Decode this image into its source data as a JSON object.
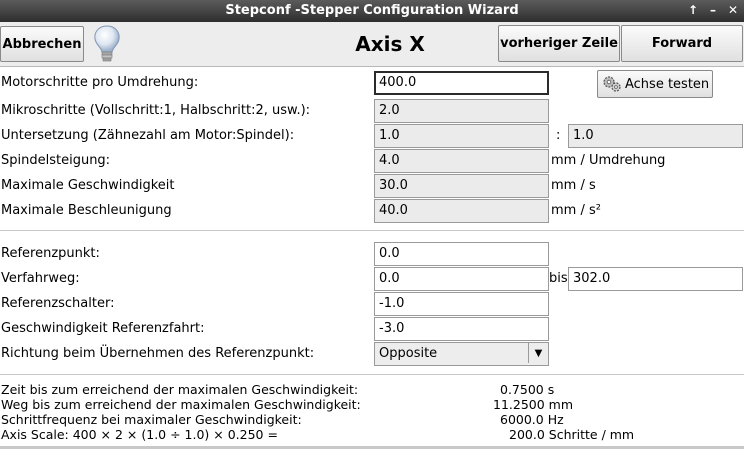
{
  "window": {
    "title": "Stepconf -Stepper Configuration Wizard"
  },
  "toolbar": {
    "cancel_label": "Abbrechen",
    "heading": "Axis X",
    "prev_label": "vorheriger Zeile",
    "forward_label": "Forward"
  },
  "motor": {
    "steps_label": "Motorschritte pro Umdrehung:",
    "steps_value": "400.0",
    "test_label": "Achse testen",
    "micro_label": "Mikroschritte (Vollschritt:1, Halbschritt:2, usw.):",
    "micro_value": "2.0",
    "gear_label": "Untersetzung (Zähnezahl am Motor:Spindel):",
    "gear_motor": "1.0",
    "gear_sep": ":",
    "gear_spindle": "1.0",
    "pitch_label": "Spindelsteigung:",
    "pitch_value": "4.0",
    "pitch_unit": "mm / Umdrehung",
    "speed_label": "Maximale Geschwindigkeit",
    "speed_value": "30.0",
    "speed_unit": "mm / s",
    "accel_label": "Maximale Beschleunigung",
    "accel_value": "40.0",
    "accel_unit": "mm / s²"
  },
  "homing": {
    "home_label": "Referenzpunkt:",
    "home_value": "0.0",
    "travel_label": "Verfahrweg:",
    "travel_min": "0.0",
    "travel_to": "bis",
    "travel_max": "302.0",
    "switch_label": "Referenzschalter:",
    "switch_value": "-1.0",
    "homespeed_label": "Geschwindigkeit Referenzfahrt:",
    "homespeed_value": "-3.0",
    "direction_label": "Richtung beim Übernehmen des Referenzpunkt:",
    "direction_value": "Opposite"
  },
  "info": {
    "time_label": "Zeit bis zum erreichend der maximalen Geschwindigkeit:",
    "time_value": "0.7500 s",
    "dist_label": "Weg bis zum erreichend der maximalen Geschwindigkeit:",
    "dist_value": "11.2500 mm",
    "freq_label": "Schrittfrequenz bei maximaler Geschwindigkeit:",
    "freq_value": "6000.0 Hz",
    "scale_label": "Axis Scale: 400 × 2 × (1.0 ÷ 1.0) × 0.250 =",
    "scale_value": "200.0 Schritte / mm"
  }
}
